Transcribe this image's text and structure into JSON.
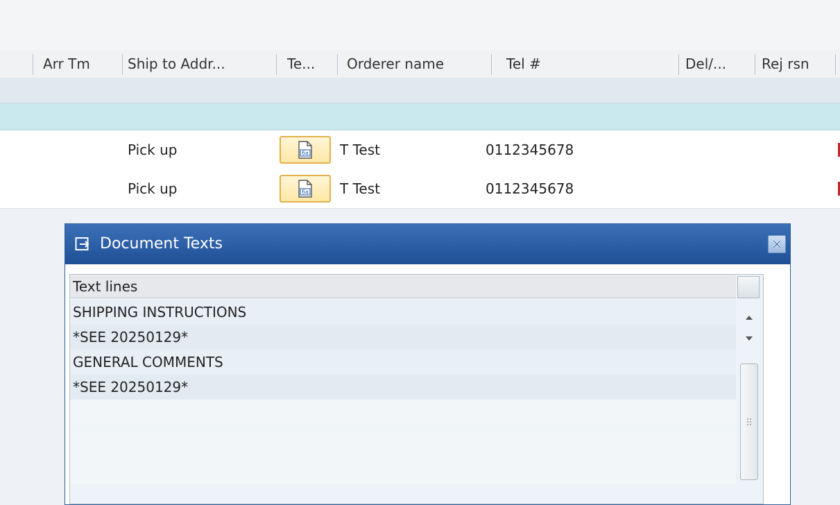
{
  "table": {
    "columns": [
      "Arr Tm",
      "Ship to Addr...",
      "Te...",
      "Orderer name",
      "Tel #",
      "Del/...",
      "Rej rsn"
    ],
    "rows": [
      {
        "ship_to": "Pick up",
        "orderer": "T Test",
        "tel": "0112345678"
      },
      {
        "ship_to": "Pick up",
        "orderer": "T Test",
        "tel": "0112345678"
      }
    ],
    "text_button_icon": "document-text-icon"
  },
  "dialog": {
    "title": "Document Texts",
    "title_icon": "document-link-icon",
    "close_icon": "close-icon",
    "grid": {
      "header": "Text lines",
      "lines": [
        "SHIPPING INSTRUCTIONS",
        "*SEE 20250129*",
        "GENERAL COMMENTS",
        "*SEE 20250129*"
      ]
    }
  },
  "colors": {
    "dialog_title_bar": "#2a5ea8",
    "selected_band": "#c9e9ee",
    "button_highlight": "#ffe7a6"
  }
}
